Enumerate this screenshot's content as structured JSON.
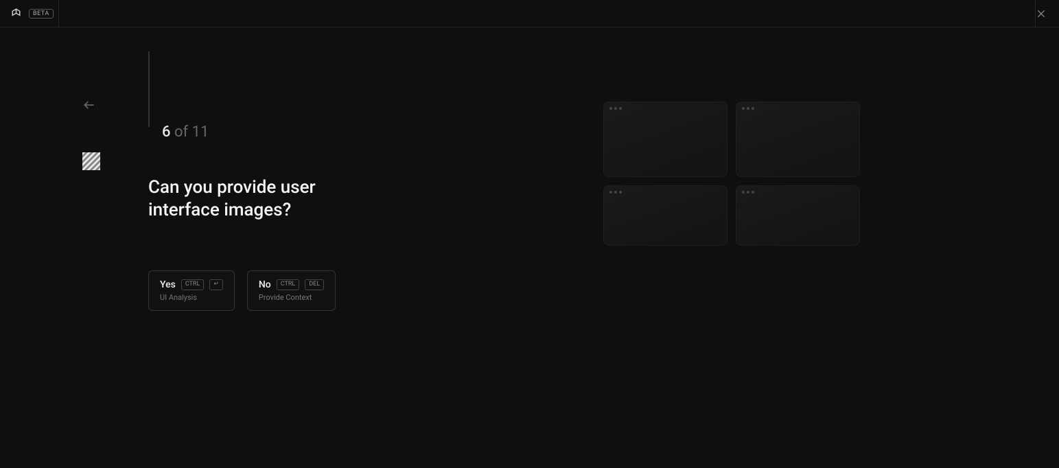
{
  "header": {
    "badge": "BETA"
  },
  "progress": {
    "current": "6",
    "separator": " of ",
    "total": "11"
  },
  "question": "Can you provide user interface images?",
  "options": {
    "yes": {
      "label": "Yes",
      "key1": "CTRL",
      "key2": "↵",
      "subtitle": "UI Analysis"
    },
    "no": {
      "label": "No",
      "key1": "CTRL",
      "key2": "DEL",
      "subtitle": "Provide Context"
    }
  }
}
